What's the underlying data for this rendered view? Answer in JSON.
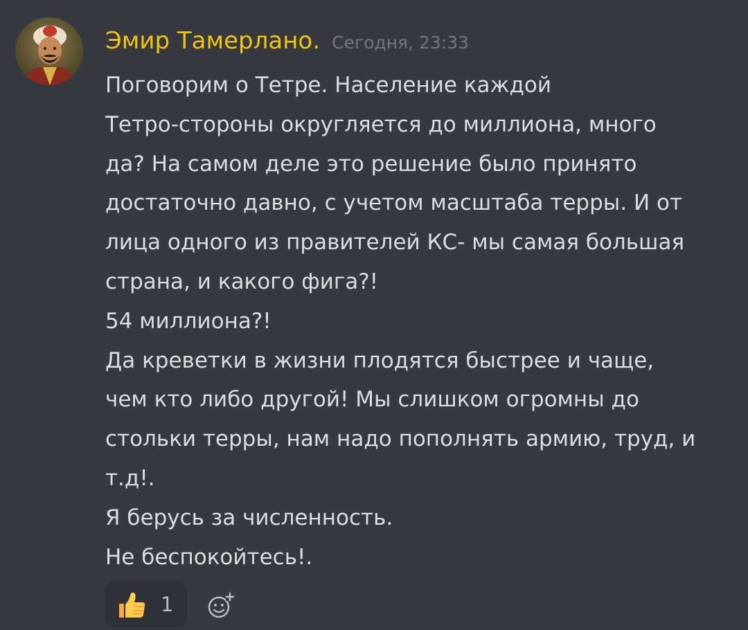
{
  "message": {
    "author": "Эмир Тамерлано.",
    "timestamp": "Сегодня, 23:33",
    "lines": [
      "Поговорим о Тетре. Население каждой",
      "Тетро-стороны округляется до миллиона, много",
      "да? На самом деле это решение было принято",
      "достаточно давно, с учетом масштаба терры. И от",
      "лица одного из правителей КС- мы самая большая",
      "страна, и какого фига?!",
      "54 миллиона?!",
      "Да креветки в жизни плодятся быстрее и чаще,",
      "чем кто либо другой! Мы слишком огромны до",
      "стольки терры, нам надо пополнять армию, труд, и",
      "т.д!.",
      "Я берусь за численность.",
      "Не беспокойтесь!."
    ]
  },
  "reactions": [
    {
      "emoji": "thumbs-up-icon",
      "count": "1"
    }
  ],
  "add_reaction_icon": "add-reaction-smiley-icon",
  "colors": {
    "background": "#36393f",
    "username": "#f1c40f",
    "timestamp": "#72767d",
    "text": "#dcddde",
    "reaction_bg": "#2f3136"
  }
}
